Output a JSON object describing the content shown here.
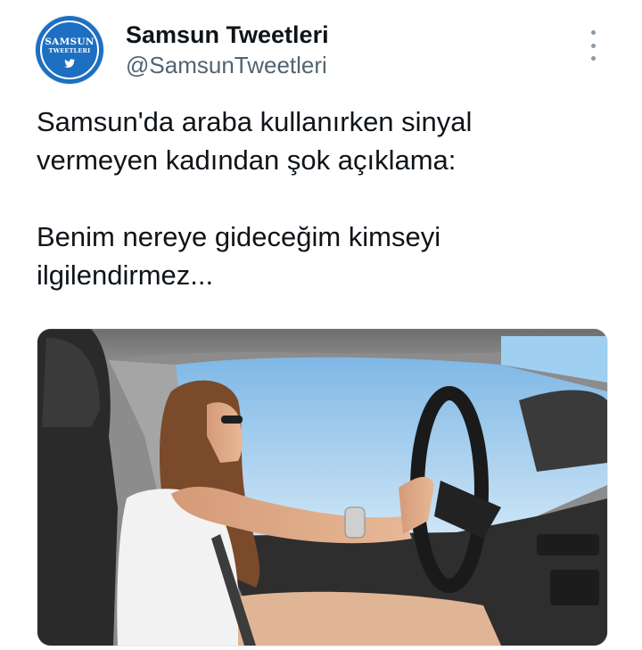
{
  "tweet": {
    "author": {
      "display_name": "Samsun Tweetleri",
      "handle": "@SamsunTweetleri",
      "avatar": {
        "line1": "SAMSUN",
        "line2": "TWEETLERI",
        "icon": "twitter-bird-icon"
      }
    },
    "menu_icon": "more-vertical-icon",
    "text": "Samsun'da araba kullanırken sinyal\nvermeyen kadından şok açıklama:\n\nBenim nereye gideceğim kimseyi\nilgilendirmez...",
    "media": {
      "type": "photo"
    }
  },
  "colors": {
    "text_primary": "#0f1419",
    "text_secondary": "#536471",
    "avatar_blue": "#1d6fc1"
  }
}
